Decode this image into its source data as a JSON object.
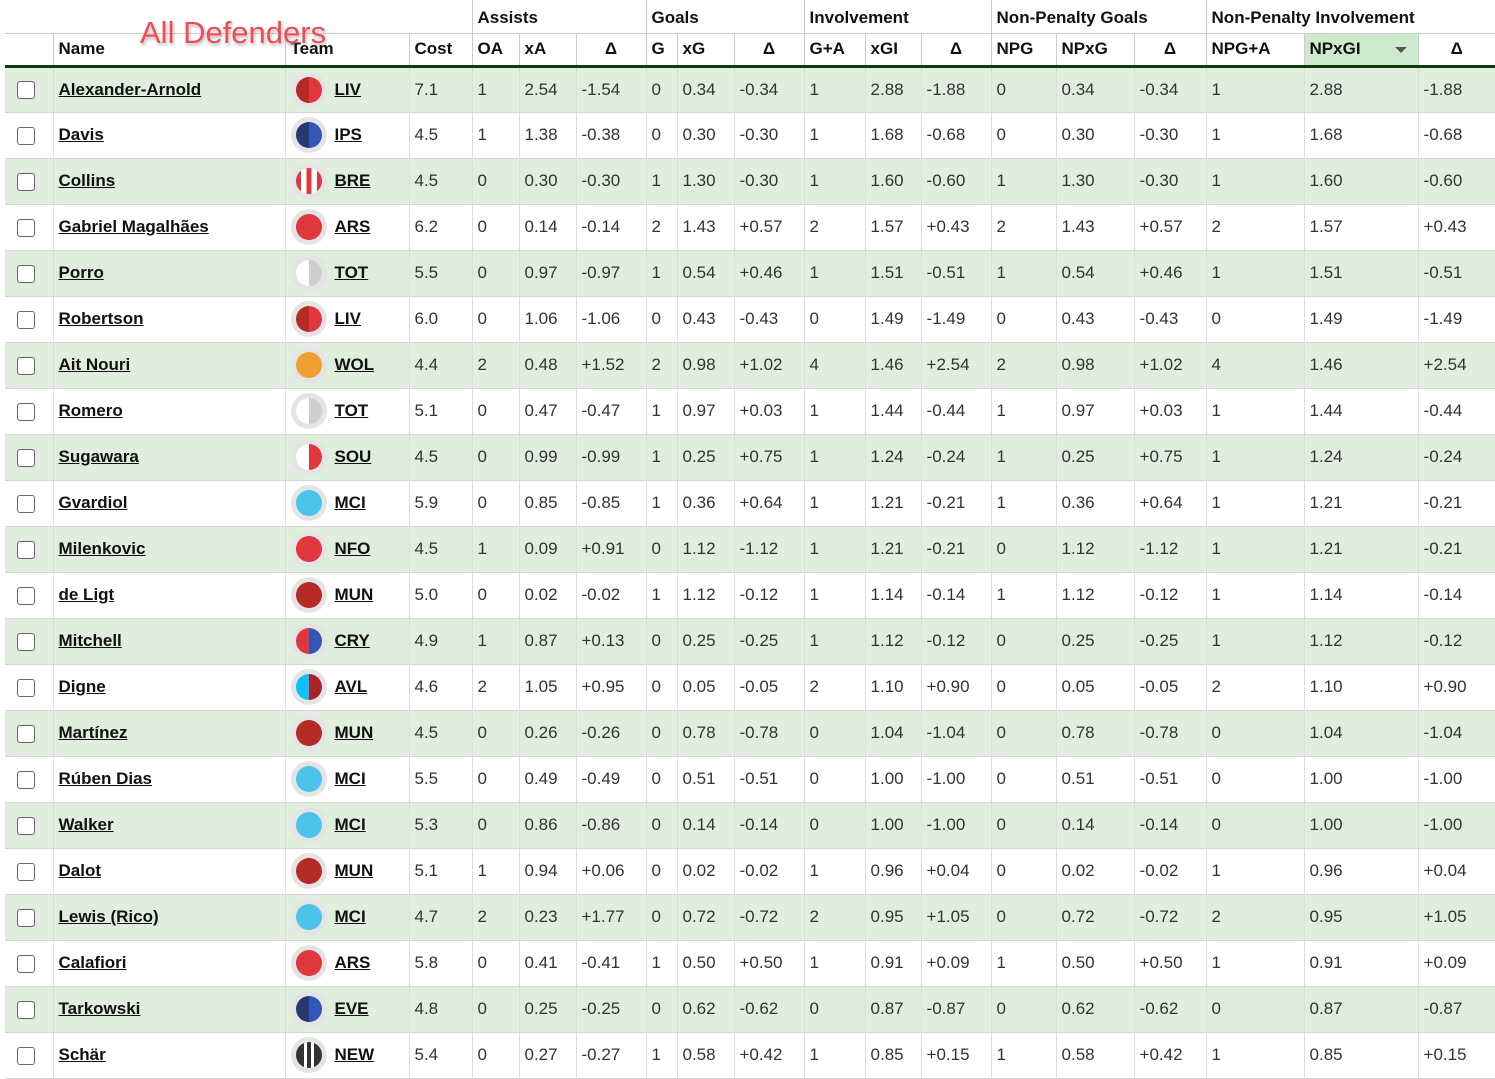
{
  "title": "All Defenders",
  "groups": [
    {
      "label": "",
      "span": 4
    },
    {
      "label": "Assists",
      "span": 3
    },
    {
      "label": "Goals",
      "span": 3
    },
    {
      "label": "Involvement",
      "span": 3
    },
    {
      "label": "Non-Penalty Goals",
      "span": 3
    },
    {
      "label": "Non-Penalty Involvement",
      "span": 3
    }
  ],
  "columns": [
    "",
    "Name",
    "Team",
    "Cost",
    "OA",
    "xA",
    "Δ",
    "G",
    "xG",
    "Δ",
    "G+A",
    "xGI",
    "Δ",
    "NPG",
    "NPxG",
    "Δ",
    "NPG+A",
    "NPxGI",
    "Δ"
  ],
  "sorted_column": "NPxGI",
  "sort_direction": "descending",
  "team_badges": {
    "LIV": "linear-gradient(90deg,#b52a25 50%,#e0373c 50%)",
    "IPS": "linear-gradient(90deg,#263a70 50%,#3057b8 50%)",
    "BRE": "linear-gradient(90deg,#e0373c 20%,#fff 20%,#fff 40%,#e0373c 40%,#e0373c 60%,#fff 60%,#fff 80%,#e0373c 80%)",
    "ARS": "#e0373c",
    "TOT": "linear-gradient(90deg,#fff 50%,#cfcfcf 50%)",
    "WOL": "#f0a030",
    "SOU": "linear-gradient(90deg,#fff 50%,#e0373c 50%)",
    "MCI": "#4cc3e8",
    "NFO": "#e0373c",
    "MUN": "#b52a25",
    "CRY": "linear-gradient(90deg,#e0373c 50%,#3057b8 50%)",
    "AVL": "linear-gradient(90deg,#10bfff 50%,#a8232a 50%)",
    "EVE": "linear-gradient(90deg,#263a70 50%,#3057b8 50%)",
    "NEW": "linear-gradient(90deg,#333 30%,#fff 30%,#fff 43%,#333 43%,#333 57%,#fff 57%,#fff 70%,#333 70%)"
  },
  "rows": [
    [
      "Alexander-Arnold",
      "LIV",
      "7.1",
      "1",
      "2.54",
      "-1.54",
      "0",
      "0.34",
      "-0.34",
      "1",
      "2.88",
      "-1.88",
      "0",
      "0.34",
      "-0.34",
      "1",
      "2.88",
      "-1.88"
    ],
    [
      "Davis",
      "IPS",
      "4.5",
      "1",
      "1.38",
      "-0.38",
      "0",
      "0.30",
      "-0.30",
      "1",
      "1.68",
      "-0.68",
      "0",
      "0.30",
      "-0.30",
      "1",
      "1.68",
      "-0.68"
    ],
    [
      "Collins",
      "BRE",
      "4.5",
      "0",
      "0.30",
      "-0.30",
      "1",
      "1.30",
      "-0.30",
      "1",
      "1.60",
      "-0.60",
      "1",
      "1.30",
      "-0.30",
      "1",
      "1.60",
      "-0.60"
    ],
    [
      "Gabriel Magalhães",
      "ARS",
      "6.2",
      "0",
      "0.14",
      "-0.14",
      "2",
      "1.43",
      "+0.57",
      "2",
      "1.57",
      "+0.43",
      "2",
      "1.43",
      "+0.57",
      "2",
      "1.57",
      "+0.43"
    ],
    [
      "Porro",
      "TOT",
      "5.5",
      "0",
      "0.97",
      "-0.97",
      "1",
      "0.54",
      "+0.46",
      "1",
      "1.51",
      "-0.51",
      "1",
      "0.54",
      "+0.46",
      "1",
      "1.51",
      "-0.51"
    ],
    [
      "Robertson",
      "LIV",
      "6.0",
      "0",
      "1.06",
      "-1.06",
      "0",
      "0.43",
      "-0.43",
      "0",
      "1.49",
      "-1.49",
      "0",
      "0.43",
      "-0.43",
      "0",
      "1.49",
      "-1.49"
    ],
    [
      "Ait Nouri",
      "WOL",
      "4.4",
      "2",
      "0.48",
      "+1.52",
      "2",
      "0.98",
      "+1.02",
      "4",
      "1.46",
      "+2.54",
      "2",
      "0.98",
      "+1.02",
      "4",
      "1.46",
      "+2.54"
    ],
    [
      "Romero",
      "TOT",
      "5.1",
      "0",
      "0.47",
      "-0.47",
      "1",
      "0.97",
      "+0.03",
      "1",
      "1.44",
      "-0.44",
      "1",
      "0.97",
      "+0.03",
      "1",
      "1.44",
      "-0.44"
    ],
    [
      "Sugawara",
      "SOU",
      "4.5",
      "0",
      "0.99",
      "-0.99",
      "1",
      "0.25",
      "+0.75",
      "1",
      "1.24",
      "-0.24",
      "1",
      "0.25",
      "+0.75",
      "1",
      "1.24",
      "-0.24"
    ],
    [
      "Gvardiol",
      "MCI",
      "5.9",
      "0",
      "0.85",
      "-0.85",
      "1",
      "0.36",
      "+0.64",
      "1",
      "1.21",
      "-0.21",
      "1",
      "0.36",
      "+0.64",
      "1",
      "1.21",
      "-0.21"
    ],
    [
      "Milenkovic",
      "NFO",
      "4.5",
      "1",
      "0.09",
      "+0.91",
      "0",
      "1.12",
      "-1.12",
      "1",
      "1.21",
      "-0.21",
      "0",
      "1.12",
      "-1.12",
      "1",
      "1.21",
      "-0.21"
    ],
    [
      "de Ligt",
      "MUN",
      "5.0",
      "0",
      "0.02",
      "-0.02",
      "1",
      "1.12",
      "-0.12",
      "1",
      "1.14",
      "-0.14",
      "1",
      "1.12",
      "-0.12",
      "1",
      "1.14",
      "-0.14"
    ],
    [
      "Mitchell",
      "CRY",
      "4.9",
      "1",
      "0.87",
      "+0.13",
      "0",
      "0.25",
      "-0.25",
      "1",
      "1.12",
      "-0.12",
      "0",
      "0.25",
      "-0.25",
      "1",
      "1.12",
      "-0.12"
    ],
    [
      "Digne",
      "AVL",
      "4.6",
      "2",
      "1.05",
      "+0.95",
      "0",
      "0.05",
      "-0.05",
      "2",
      "1.10",
      "+0.90",
      "0",
      "0.05",
      "-0.05",
      "2",
      "1.10",
      "+0.90"
    ],
    [
      "Martínez",
      "MUN",
      "4.5",
      "0",
      "0.26",
      "-0.26",
      "0",
      "0.78",
      "-0.78",
      "0",
      "1.04",
      "-1.04",
      "0",
      "0.78",
      "-0.78",
      "0",
      "1.04",
      "-1.04"
    ],
    [
      "Rúben Dias",
      "MCI",
      "5.5",
      "0",
      "0.49",
      "-0.49",
      "0",
      "0.51",
      "-0.51",
      "0",
      "1.00",
      "-1.00",
      "0",
      "0.51",
      "-0.51",
      "0",
      "1.00",
      "-1.00"
    ],
    [
      "Walker",
      "MCI",
      "5.3",
      "0",
      "0.86",
      "-0.86",
      "0",
      "0.14",
      "-0.14",
      "0",
      "1.00",
      "-1.00",
      "0",
      "0.14",
      "-0.14",
      "0",
      "1.00",
      "-1.00"
    ],
    [
      "Dalot",
      "MUN",
      "5.1",
      "1",
      "0.94",
      "+0.06",
      "0",
      "0.02",
      "-0.02",
      "1",
      "0.96",
      "+0.04",
      "0",
      "0.02",
      "-0.02",
      "1",
      "0.96",
      "+0.04"
    ],
    [
      "Lewis (Rico)",
      "MCI",
      "4.7",
      "2",
      "0.23",
      "+1.77",
      "0",
      "0.72",
      "-0.72",
      "2",
      "0.95",
      "+1.05",
      "0",
      "0.72",
      "-0.72",
      "2",
      "0.95",
      "+1.05"
    ],
    [
      "Calafiori",
      "ARS",
      "5.8",
      "0",
      "0.41",
      "-0.41",
      "1",
      "0.50",
      "+0.50",
      "1",
      "0.91",
      "+0.09",
      "1",
      "0.50",
      "+0.50",
      "1",
      "0.91",
      "+0.09"
    ],
    [
      "Tarkowski",
      "EVE",
      "4.8",
      "0",
      "0.25",
      "-0.25",
      "0",
      "0.62",
      "-0.62",
      "0",
      "0.87",
      "-0.87",
      "0",
      "0.62",
      "-0.62",
      "0",
      "0.87",
      "-0.87"
    ],
    [
      "Schär",
      "NEW",
      "5.4",
      "0",
      "0.27",
      "-0.27",
      "1",
      "0.58",
      "+0.42",
      "1",
      "0.85",
      "+0.15",
      "1",
      "0.58",
      "+0.42",
      "1",
      "0.85",
      "+0.15"
    ]
  ]
}
